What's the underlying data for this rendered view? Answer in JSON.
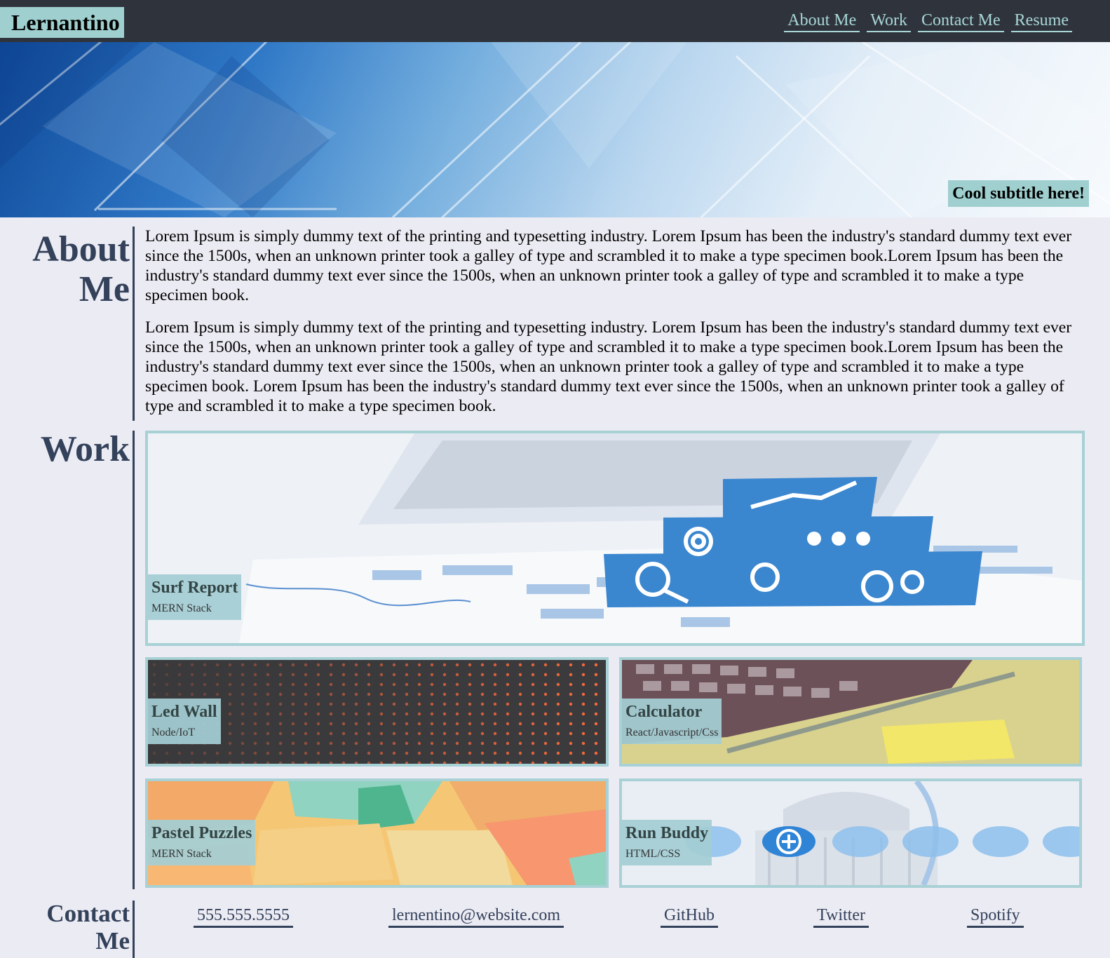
{
  "header": {
    "brand": "Lernantino",
    "nav": [
      "About Me",
      "Work",
      "Contact Me",
      "Resume"
    ]
  },
  "hero": {
    "subtitle": "Cool subtitle here!"
  },
  "about": {
    "title": "About Me",
    "paragraphs": [
      "Lorem Ipsum is simply dummy text of the printing and typesetting industry. Lorem Ipsum has been the industry's standard dummy text ever since the 1500s, when an unknown printer took a galley of type and scrambled it to make a type specimen book.Lorem Ipsum has been the industry's standard dummy text ever since the 1500s, when an unknown printer took a galley of type and scrambled it to make a type specimen book.",
      "Lorem Ipsum is simply dummy text of the printing and typesetting industry. Lorem Ipsum has been the industry's standard dummy text ever since the 1500s, when an unknown printer took a galley of type and scrambled it to make a type specimen book.Lorem Ipsum has been the industry's standard dummy text ever since the 1500s, when an unknown printer took a galley of type and scrambled it to make a type specimen book. Lorem Ipsum has been the industry's standard dummy text ever since the 1500s, when an unknown printer took a galley of type and scrambled it to make a type specimen book."
    ]
  },
  "work": {
    "title": "Work",
    "projects": [
      {
        "title": "Surf Report",
        "stack": "MERN Stack"
      },
      {
        "title": "Led Wall",
        "stack": "Node/IoT"
      },
      {
        "title": "Calculator",
        "stack": "React/Javascript/Css"
      },
      {
        "title": "Pastel Puzzles",
        "stack": "MERN Stack"
      },
      {
        "title": "Run Buddy",
        "stack": "HTML/CSS"
      }
    ]
  },
  "contact": {
    "title": "Contact Me",
    "links": [
      "555.555.5555",
      "lernentino@website.com",
      "GitHub",
      "Twitter",
      "Spotify"
    ]
  },
  "colors": {
    "navbar": "#2f343c",
    "accent": "#9fcfcf",
    "heading": "#33415a",
    "card_border": "#a8d1d6",
    "background": "#ebebf3"
  }
}
